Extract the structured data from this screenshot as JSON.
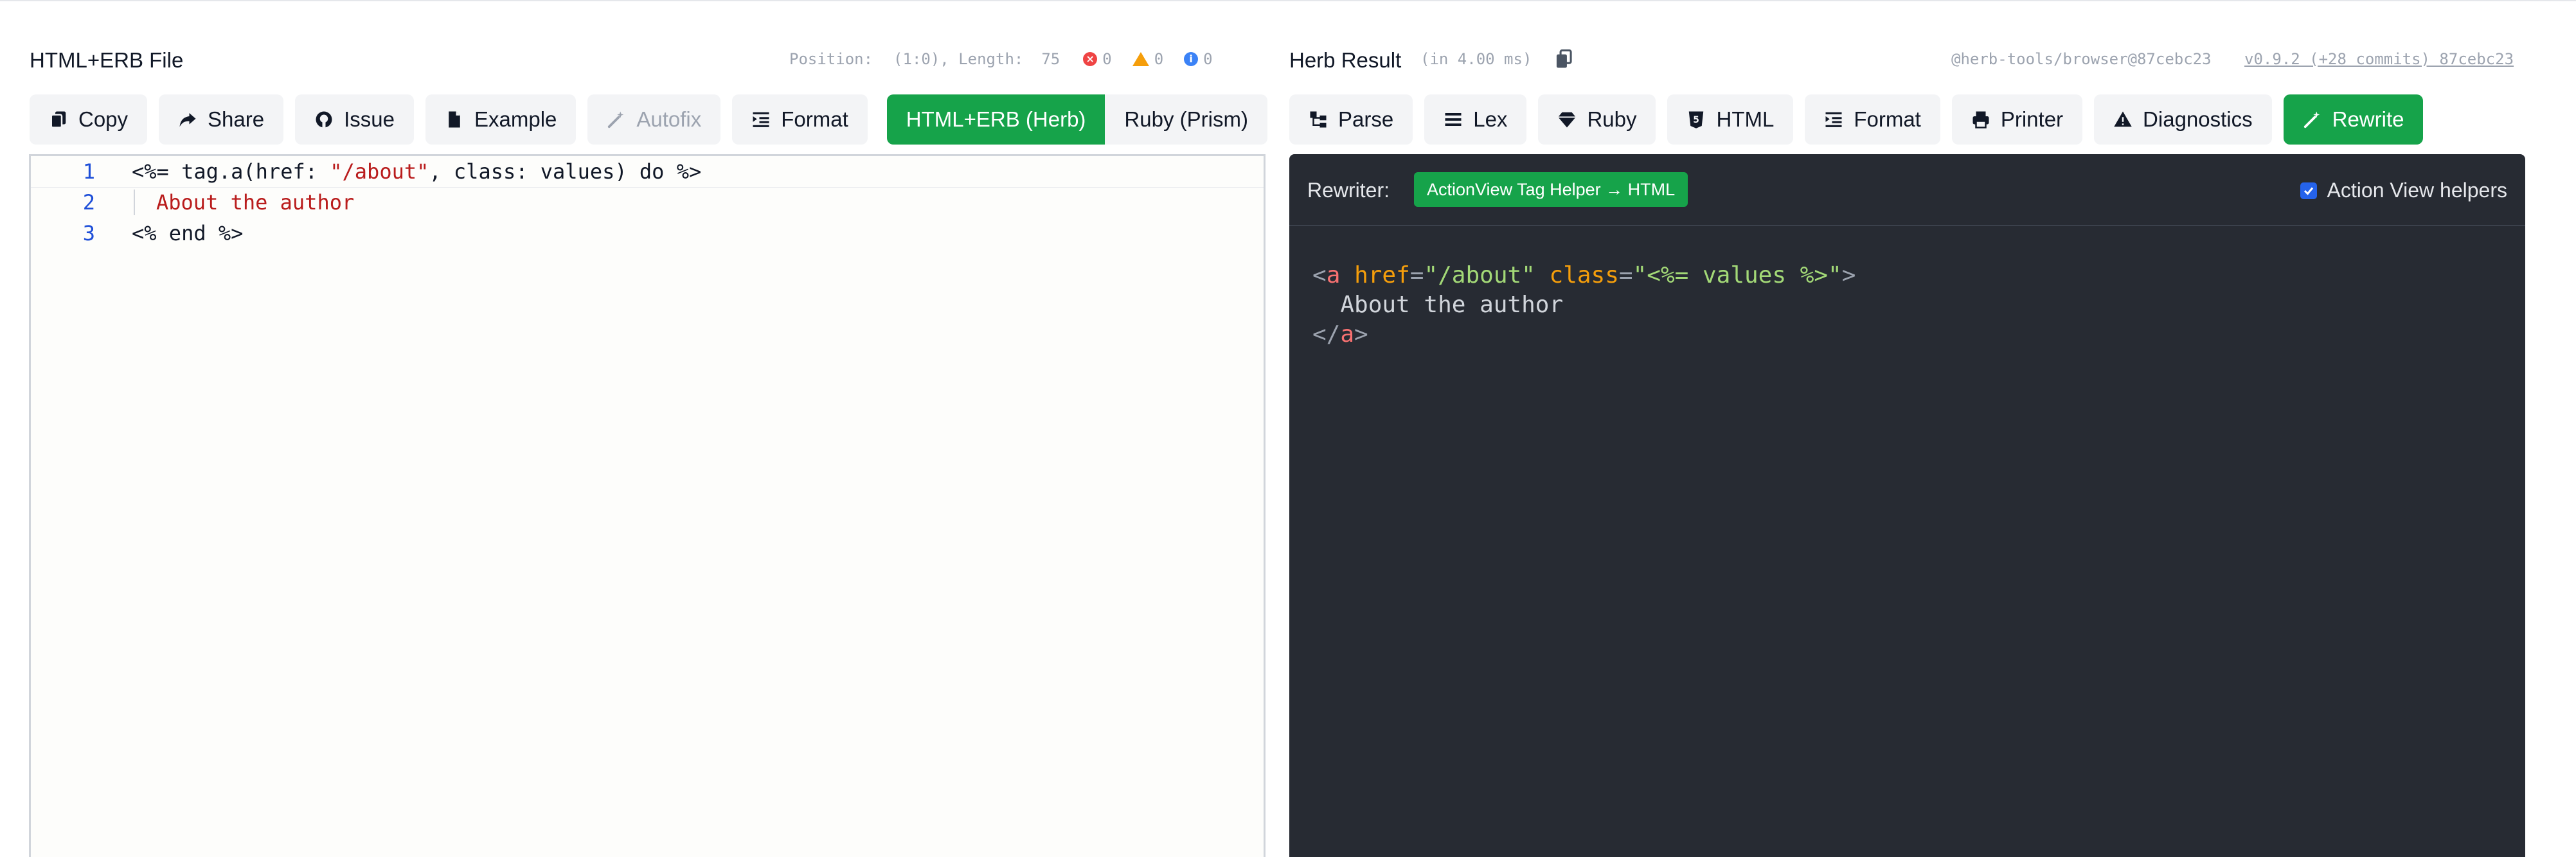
{
  "left": {
    "title": "HTML+ERB File",
    "position_label": "Position:",
    "position_value": "(1:0), Length:",
    "length_value": "75",
    "errors": "0",
    "warnings": "0",
    "infos": "0",
    "buttons": {
      "copy": "Copy",
      "share": "Share",
      "issue": "Issue",
      "example": "Example",
      "autofix": "Autofix",
      "format": "Format"
    },
    "modes": {
      "herb": "HTML+ERB (Herb)",
      "prism": "Ruby (Prism)"
    },
    "editor": {
      "line_numbers": [
        "1",
        "2",
        "3"
      ],
      "l1_a": "<%= tag.a(href: ",
      "l1_str": "\"/about\"",
      "l1_b": ", class: values) do %>",
      "l2": "About the author",
      "l3": "<% end %>"
    }
  },
  "right": {
    "title": "Herb Result",
    "timing": "(in 4.00 ms)",
    "package": "@herb-tools/browser@87cebc23",
    "version_link": "v0.9.2 (+28 commits) 87cebc23",
    "buttons": {
      "parse": "Parse",
      "lex": "Lex",
      "ruby": "Ruby",
      "html": "HTML",
      "format": "Format",
      "printer": "Printer",
      "diagnostics": "Diagnostics",
      "rewrite": "Rewrite"
    },
    "rewriter_label": "Rewriter:",
    "rewriter_badge": "ActionView Tag Helper → HTML",
    "action_view_label": "Action View helpers",
    "action_view_checked": true,
    "output": {
      "open_lt": "<",
      "tag": "a",
      "attr_href": "href",
      "eq": "=",
      "href_val": "\"/about\"",
      "attr_class": "class",
      "class_q1": "\"",
      "class_erb": "<%= values %>",
      "class_q2": "\"",
      "gt": ">",
      "text": "  About the author",
      "close_lt": "</",
      "close_tag": "a",
      "close_gt": ">"
    }
  }
}
